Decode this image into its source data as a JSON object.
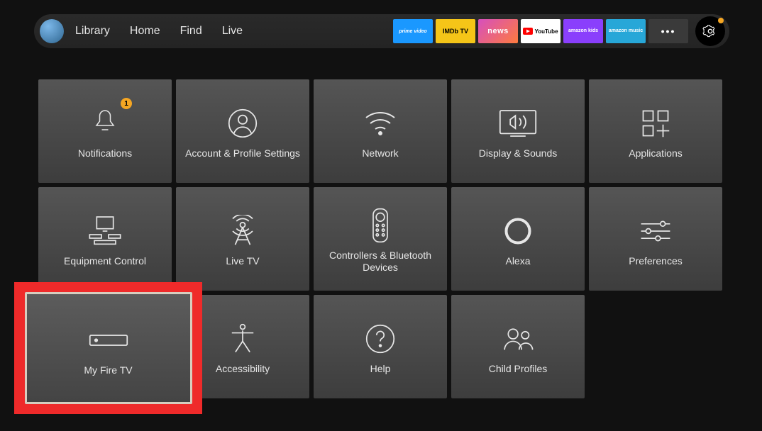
{
  "nav": {
    "tabs": [
      "Library",
      "Home",
      "Find",
      "Live"
    ],
    "apps": [
      {
        "name": "prime-video",
        "label": "prime video",
        "class": "pv"
      },
      {
        "name": "imdb-tv",
        "label": "IMDb TV",
        "class": "imdb"
      },
      {
        "name": "news",
        "label": "news",
        "class": "news"
      },
      {
        "name": "youtube",
        "label": "YouTube",
        "class": "yt"
      },
      {
        "name": "amazon-kids",
        "label": "amazon kids",
        "class": "kids"
      },
      {
        "name": "amazon-music",
        "label": "amazon music",
        "class": "amzmusic"
      },
      {
        "name": "more",
        "label": "•••",
        "class": "more-tile"
      }
    ],
    "settings_notification": true
  },
  "settings": {
    "tiles": [
      {
        "key": "notifications",
        "label": "Notifications",
        "icon": "bell-icon",
        "badge": "1"
      },
      {
        "key": "account",
        "label": "Account & Profile Settings",
        "icon": "user-circle-icon"
      },
      {
        "key": "network",
        "label": "Network",
        "icon": "wifi-icon"
      },
      {
        "key": "display",
        "label": "Display & Sounds",
        "icon": "tv-sound-icon"
      },
      {
        "key": "applications",
        "label": "Applications",
        "icon": "apps-icon"
      },
      {
        "key": "equipment",
        "label": "Equipment Control",
        "icon": "equipment-icon"
      },
      {
        "key": "livetv",
        "label": "Live TV",
        "icon": "antenna-icon"
      },
      {
        "key": "controllers",
        "label": "Controllers & Bluetooth Devices",
        "icon": "remote-icon"
      },
      {
        "key": "alexa",
        "label": "Alexa",
        "icon": "alexa-ring-icon"
      },
      {
        "key": "preferences",
        "label": "Preferences",
        "icon": "sliders-icon"
      },
      {
        "key": "myfiretv",
        "label": "My Fire TV",
        "icon": "firetv-box-icon",
        "highlighted": true
      },
      {
        "key": "accessibility",
        "label": "Accessibility",
        "icon": "accessibility-icon"
      },
      {
        "key": "help",
        "label": "Help",
        "icon": "help-circle-icon"
      },
      {
        "key": "childprofiles",
        "label": "Child Profiles",
        "icon": "child-profiles-icon"
      }
    ]
  }
}
